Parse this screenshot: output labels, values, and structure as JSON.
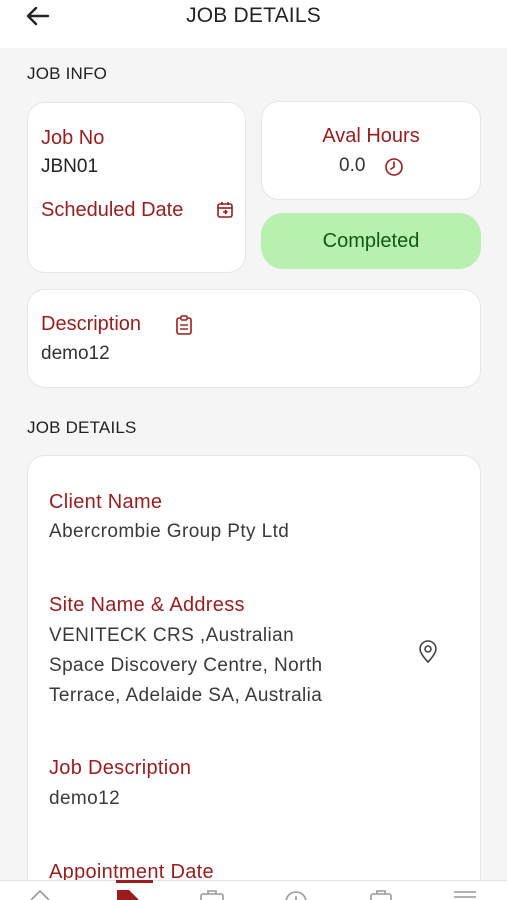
{
  "header": {
    "title": "JOB DETAILS"
  },
  "job_info": {
    "section_title": "JOB INFO",
    "job_no_label": "Job No",
    "job_no": "JBN01",
    "scheduled_date_label": "Scheduled Date",
    "aval_hours_label": "Aval Hours",
    "aval_hours": "0.0",
    "status": "Completed",
    "description_label": "Description",
    "description": "demo12"
  },
  "job_details": {
    "section_title": "JOB DETAILS",
    "client_name_label": "Client Name",
    "client_name": "Abercrombie Group Pty Ltd",
    "site_label": "Site Name & Address",
    "site_line1": "VENITECK CRS ,Australian",
    "site_line2": "Space Discovery Centre, North",
    "site_line3": "Terrace, Adelaide SA, Australia",
    "job_description_label": "Job Description",
    "job_description": "demo12",
    "appointment_date_label": "Appointment Date"
  },
  "colors": {
    "accent": "#9b1c1c",
    "status_bg": "#b8f0b0",
    "status_text": "#0f5a12"
  }
}
